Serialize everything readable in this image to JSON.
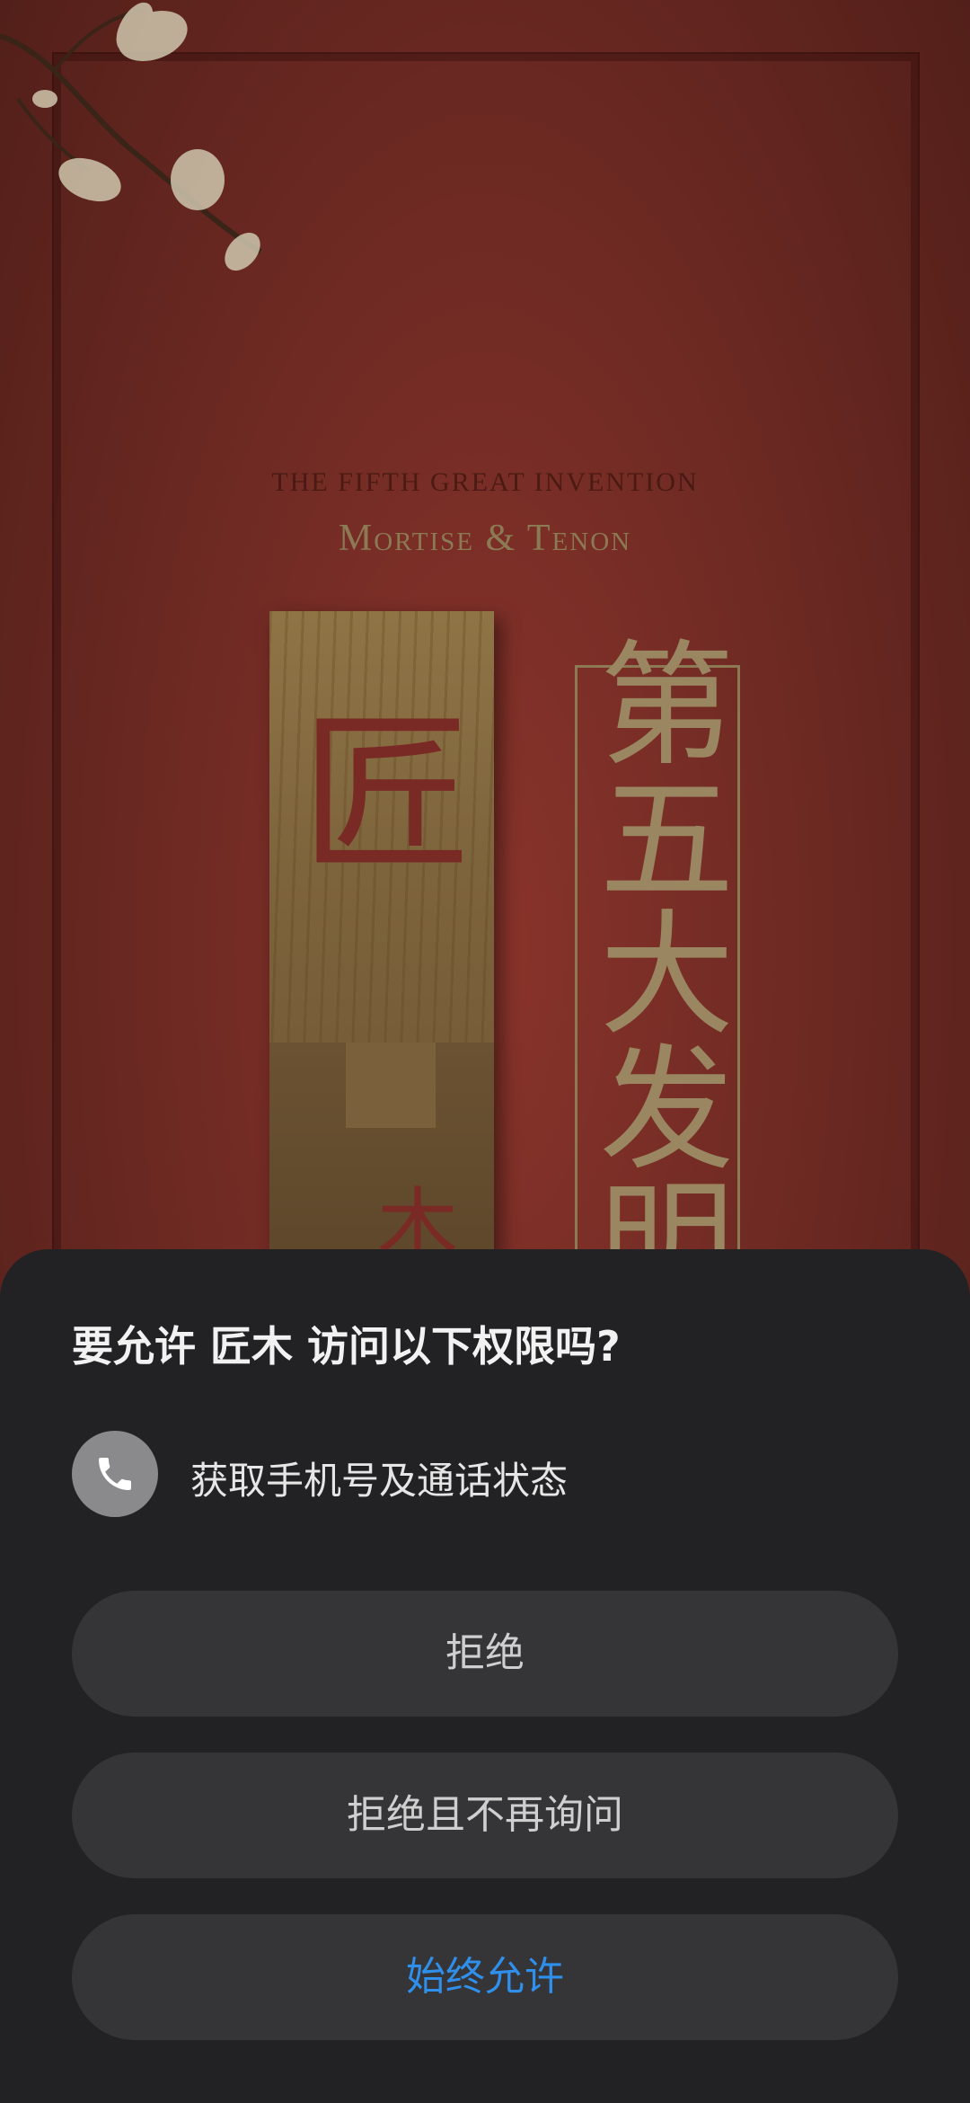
{
  "splash": {
    "tagline_en": "THE FIFTH GREAT INVENTION",
    "title_en": "Mortise & Tenon",
    "wood_char_top": "匠",
    "wood_char_bottom": "木",
    "vertical_title": "第五大发明",
    "colors": {
      "background": "#6e2a23",
      "gold": "#9a8660",
      "wood": "#7d643c"
    }
  },
  "permission_dialog": {
    "title": "要允许 匠木 访问以下权限吗?",
    "permission": {
      "icon": "phone-icon",
      "label": "获取手机号及通话状态"
    },
    "buttons": {
      "deny": "拒绝",
      "deny_forever": "拒绝且不再询问",
      "allow_always": "始终允许"
    },
    "colors": {
      "sheet": "#222224",
      "button": "#353537",
      "accent": "#2f8fea"
    }
  }
}
